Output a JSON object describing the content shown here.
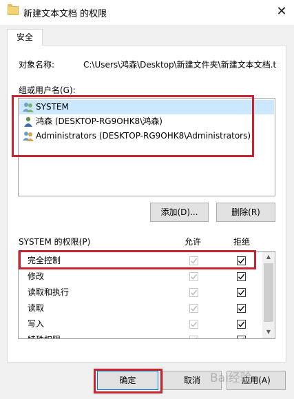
{
  "window": {
    "title": "新建文本文档 的权限",
    "close_glyph": "✕"
  },
  "tab": {
    "label": "安全"
  },
  "object": {
    "label": "对象名称:",
    "value": "C:\\Users\\鸿森\\Desktop\\新建文件夹\\新建文本文档.t"
  },
  "groups": {
    "label": "组或用户名(G):",
    "items": [
      {
        "name": "SYSTEM",
        "icon": "user-group-icon",
        "selected": true
      },
      {
        "name": "鸿森 (DESKTOP-RG9OHK8\\鸿森)",
        "icon": "user-icon",
        "selected": false
      },
      {
        "name": "Administrators (DESKTOP-RG9OHK8\\Administrators)",
        "icon": "user-group-icon",
        "selected": false
      }
    ]
  },
  "buttons": {
    "add": "添加(D)...",
    "remove": "删除(R)",
    "ok": "确定",
    "cancel": "取消",
    "apply": "应用(A)"
  },
  "permissions": {
    "title": "SYSTEM 的权限(P)",
    "allow_header": "允许",
    "deny_header": "拒绝",
    "rows": [
      {
        "name": "完全控制",
        "allow": true,
        "deny": true
      },
      {
        "name": "修改",
        "allow": true,
        "deny": true
      },
      {
        "name": "读取和执行",
        "allow": true,
        "deny": true
      },
      {
        "name": "读取",
        "allow": true,
        "deny": true
      },
      {
        "name": "写入",
        "allow": true,
        "deny": true
      },
      {
        "name": "特殊权限",
        "allow": true,
        "deny": true
      }
    ]
  },
  "watermark": "Bai经验",
  "colors": {
    "highlight": "#c8232f",
    "selection": "#cce8ff",
    "default_button_border": "#0078d7"
  }
}
